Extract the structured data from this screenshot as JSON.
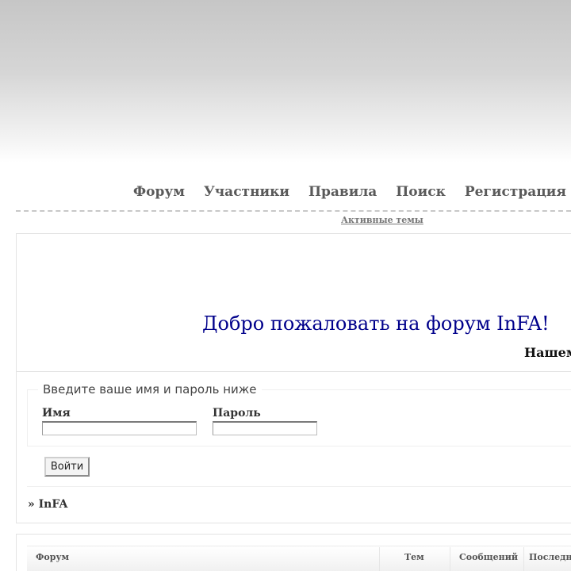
{
  "nav": {
    "items": [
      {
        "label": "Форум"
      },
      {
        "label": "Участники"
      },
      {
        "label": "Правила"
      },
      {
        "label": "Поиск"
      },
      {
        "label": "Регистрация"
      }
    ],
    "active_topics": "Активные темы"
  },
  "announcement": {
    "welcome": "Добро пожаловать на форум InFA!",
    "partial": "Нашем"
  },
  "login": {
    "legend": "Введите ваше имя и пароль ниже",
    "username_label": "Имя",
    "password_label": "Пароль",
    "username_value": "",
    "password_value": "",
    "submit_label": "Войти"
  },
  "breadcrumb": {
    "prefix": "»",
    "forum_name": "InFA"
  },
  "forum_table": {
    "columns": [
      "Форум",
      "Тем",
      "Сообщений",
      "Последн"
    ]
  },
  "colors": {
    "welcome_text": "#00008b",
    "nav_text": "#5a5a5a"
  }
}
